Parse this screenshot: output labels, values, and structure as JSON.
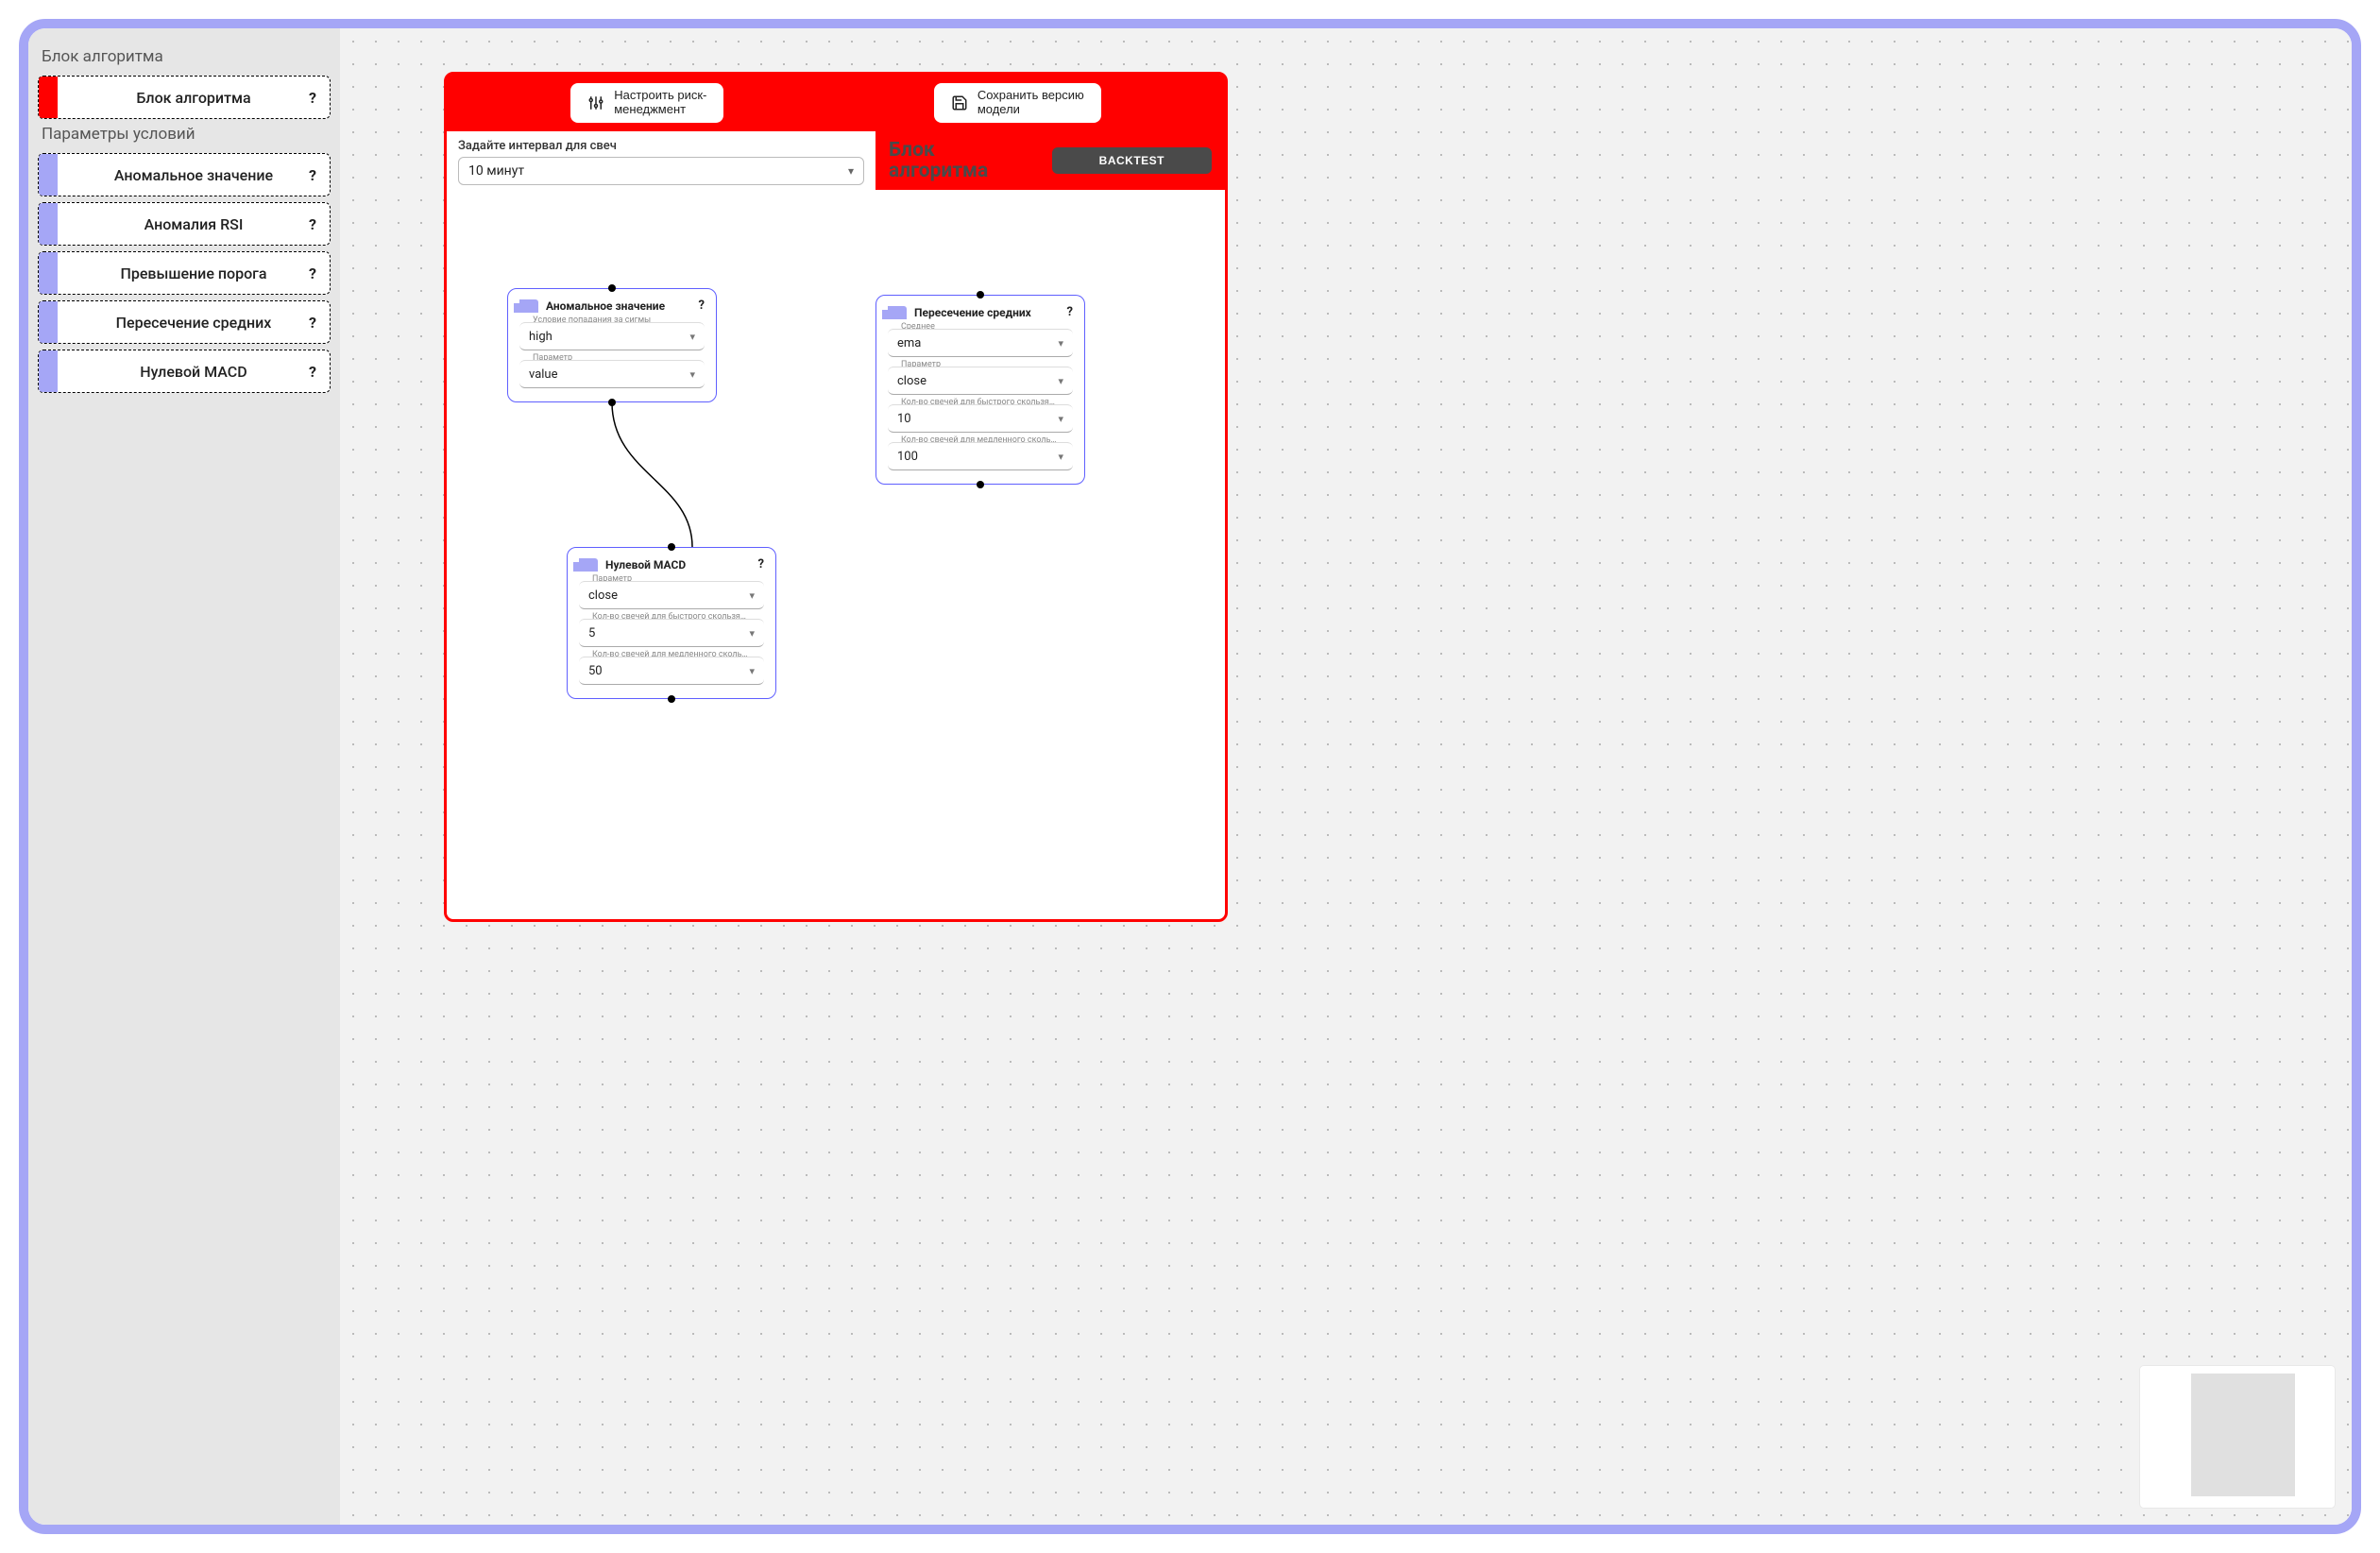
{
  "sidebar": {
    "sections": [
      {
        "title": "Блок алгоритма",
        "items": [
          {
            "label": "Блок алгоритма",
            "swatch": "red",
            "help": "?"
          }
        ]
      },
      {
        "title": "Параметры условий",
        "items": [
          {
            "label": "Аномальное значение",
            "swatch": "violet",
            "help": "?"
          },
          {
            "label": "Аномалия RSI",
            "swatch": "violet",
            "help": "?"
          },
          {
            "label": "Превышение порога",
            "swatch": "violet",
            "help": "?"
          },
          {
            "label": "Пересечение средних",
            "swatch": "violet",
            "help": "?"
          },
          {
            "label": "Нулевой MACD",
            "swatch": "violet",
            "help": "?"
          }
        ]
      }
    ]
  },
  "workspace": {
    "header": {
      "risk_label": "Настроить риск-\nменеджмент",
      "save_label": "Сохранить версию\nмодели"
    },
    "interval": {
      "label": "Задайте интервал для свеч",
      "value": "10 минут"
    },
    "title": "Блок алгоритма",
    "backtest_label": "BACKTEST"
  },
  "nodes": {
    "anomaly": {
      "title": "Аномальное значение",
      "help": "?",
      "fields": [
        {
          "label": "Условие попадания за сигмы",
          "value": "high"
        },
        {
          "label": "Параметр",
          "value": "value"
        }
      ]
    },
    "macd": {
      "title": "Нулевой MACD",
      "help": "?",
      "fields": [
        {
          "label": "Параметр",
          "value": "close"
        },
        {
          "label": "Кол-во свечей для быстрого скользящего...",
          "value": "5"
        },
        {
          "label": "Кол-во свечей для медленного скользящ...",
          "value": "50"
        }
      ]
    },
    "cross": {
      "title": "Пересечение средних",
      "help": "?",
      "fields": [
        {
          "label": "Среднее",
          "value": "ema"
        },
        {
          "label": "Параметр",
          "value": "close"
        },
        {
          "label": "Кол-во свечей для быстрого скользящего...",
          "value": "10"
        },
        {
          "label": "Кол-во свечей для медленного скользящ...",
          "value": "100"
        }
      ]
    }
  },
  "colors": {
    "accent_red": "#FF0000",
    "accent_violet": "#A5A6F6",
    "node_border": "#5f5fff"
  }
}
